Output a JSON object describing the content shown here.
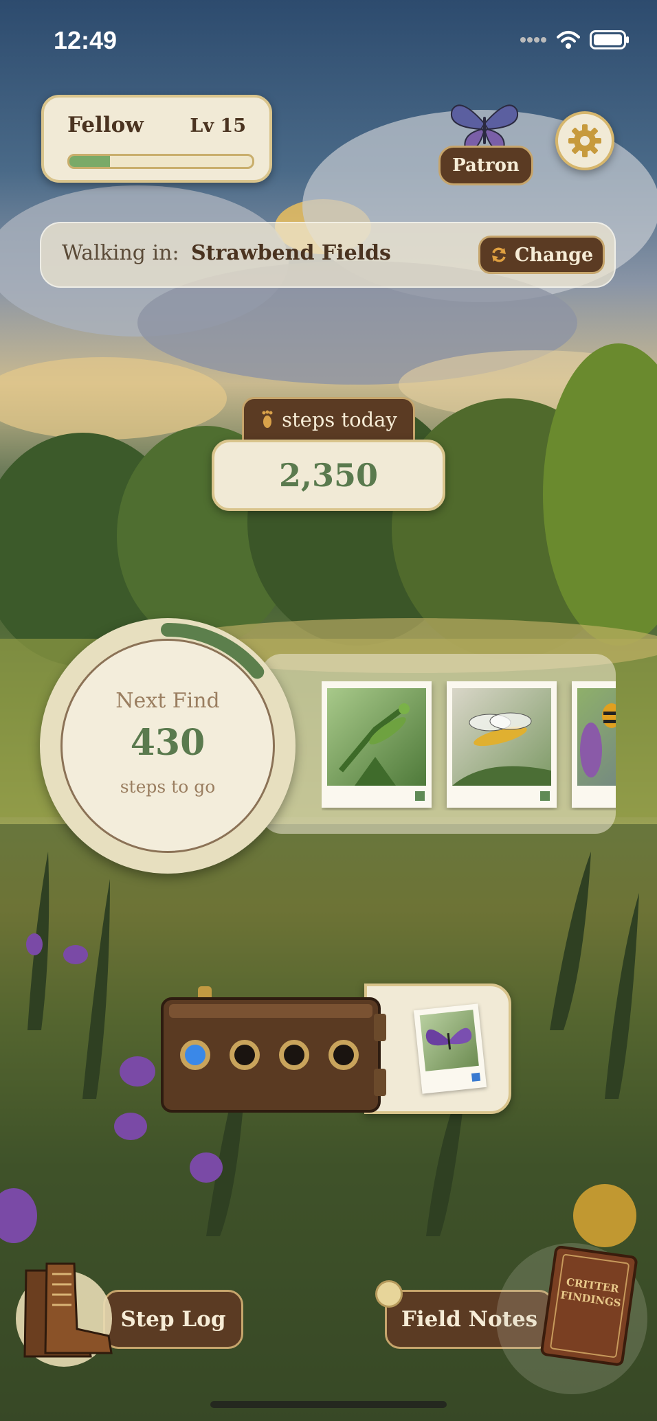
{
  "status_bar": {
    "time": "12:49"
  },
  "profile": {
    "rank": "Fellow",
    "level": "Lv 15",
    "xp_progress": 0.22
  },
  "patron": {
    "label": "Patron"
  },
  "location": {
    "label": "Walking in:",
    "value": "Strawbend Fields",
    "change_label": "Change"
  },
  "steps": {
    "label": "steps today",
    "value": "2,350"
  },
  "next_find": {
    "label": "Next Find",
    "value": "430",
    "sublabel": "steps to go",
    "progress": 0.14
  },
  "finds": [
    {
      "name": "praying-mantis",
      "tag_color": "#5f8a55"
    },
    {
      "name": "scorpionfly",
      "tag_color": "#5f8a55"
    },
    {
      "name": "bee",
      "tag_color": "#5f8a55"
    }
  ],
  "finder_box": {
    "active_slots": 1,
    "total_slots": 4,
    "latest_find": "purple-butterfly"
  },
  "nav": {
    "step_log": "Step Log",
    "field_notes": "Field Notes"
  },
  "book": {
    "line1": "CRITTER",
    "line2": "FINDINGS"
  },
  "colors": {
    "accent_green": "#5a7a4e",
    "brown": "#5b3b23",
    "cream": "#f1ead6",
    "gold": "#d9c48c"
  }
}
